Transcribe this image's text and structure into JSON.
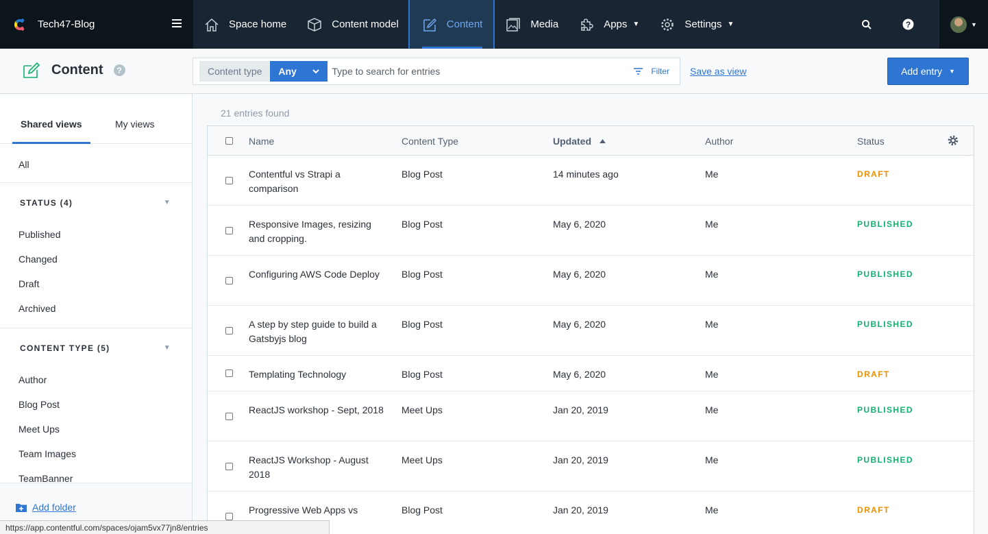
{
  "nav": {
    "space_name": "Tech47-Blog",
    "items": [
      {
        "label": "Space home",
        "icon": "home-icon"
      },
      {
        "label": "Content model",
        "icon": "cube-icon"
      },
      {
        "label": "Content",
        "icon": "edit-icon",
        "active": true
      },
      {
        "label": "Media",
        "icon": "media-icon"
      },
      {
        "label": "Apps",
        "icon": "puzzle-icon",
        "dropdown": true
      },
      {
        "label": "Settings",
        "icon": "gear-icon",
        "dropdown": true
      }
    ],
    "accent_color": "#2e75d4"
  },
  "header": {
    "title": "Content",
    "search": {
      "content_type_label": "Content type",
      "content_type_value": "Any",
      "placeholder": "Type to search for entries",
      "filter_label": "Filter"
    },
    "save_view_label": "Save as view",
    "add_entry_label": "Add entry"
  },
  "sidebar": {
    "tabs": [
      "Shared views",
      "My views"
    ],
    "all_label": "All",
    "groups": [
      {
        "title": "STATUS (4)",
        "items": [
          "Published",
          "Changed",
          "Draft",
          "Archived"
        ]
      },
      {
        "title": "CONTENT TYPE (5)",
        "items": [
          "Author",
          "Blog Post",
          "Meet Ups",
          "Team Images",
          "TeamBanner"
        ]
      }
    ],
    "add_folder_label": "Add folder"
  },
  "status_url": "https://app.contentful.com/spaces/ojam5vx77jn8/entries",
  "main": {
    "found_text": "21 entries found",
    "columns": [
      "Name",
      "Content Type",
      "Updated",
      "Author",
      "Status"
    ],
    "rows": [
      {
        "name": "Contentful vs Strapi a comparison",
        "type": "Blog Post",
        "updated": "14 minutes ago",
        "author": "Me",
        "status": "DRAFT"
      },
      {
        "name": "Responsive Images, resizing and cropping.",
        "type": "Blog Post",
        "updated": "May 6, 2020",
        "author": "Me",
        "status": "PUBLISHED"
      },
      {
        "name": "Configuring AWS Code Deploy",
        "type": "Blog Post",
        "updated": "May 6, 2020",
        "author": "Me",
        "status": "PUBLISHED"
      },
      {
        "name": "A step by step guide to build a Gatsbyjs blog",
        "type": "Blog Post",
        "updated": "May 6, 2020",
        "author": "Me",
        "status": "PUBLISHED"
      },
      {
        "name": "Templating Technology",
        "type": "Blog Post",
        "updated": "May 6, 2020",
        "author": "Me",
        "status": "DRAFT"
      },
      {
        "name": "ReactJS workshop - Sept, 2018",
        "type": "Meet Ups",
        "updated": "Jan 20, 2019",
        "author": "Me",
        "status": "PUBLISHED"
      },
      {
        "name": "ReactJS Workshop - August 2018",
        "type": "Meet Ups",
        "updated": "Jan 20, 2019",
        "author": "Me",
        "status": "PUBLISHED"
      },
      {
        "name": "Progressive Web Apps vs Native Apps",
        "type": "Blog Post",
        "updated": "Jan 20, 2019",
        "author": "Me",
        "status": "DRAFT"
      }
    ],
    "status_colors": {
      "DRAFT": "#ea9005",
      "PUBLISHED": "#14b06f"
    }
  }
}
